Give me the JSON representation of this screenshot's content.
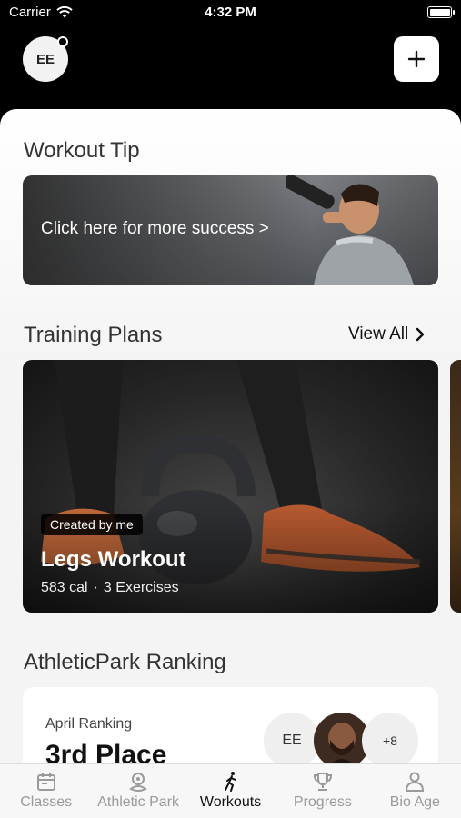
{
  "status": {
    "carrier": "Carrier",
    "time": "4:32 PM"
  },
  "header": {
    "avatar_initials": "EE",
    "add_icon": "plus-icon"
  },
  "tip": {
    "title": "Workout Tip",
    "cta": "Click here for more success >"
  },
  "plans": {
    "title": "Training Plans",
    "view_all": "View All",
    "card": {
      "badge": "Created by me",
      "name": "Legs Workout",
      "calories": "583 cal",
      "separator": "·",
      "exercises": "3 Exercises"
    }
  },
  "ranking": {
    "title": "AthleticPark Ranking",
    "label": "April Ranking",
    "place": "3rd Place",
    "avatars": {
      "first": "EE",
      "more": "+8"
    }
  },
  "tabs": [
    {
      "label": "Classes",
      "icon": "calendar-icon"
    },
    {
      "label": "Athletic Park",
      "icon": "location-pin-icon"
    },
    {
      "label": "Workouts",
      "icon": "runner-icon"
    },
    {
      "label": "Progress",
      "icon": "trophy-icon"
    },
    {
      "label": "Bio Age",
      "icon": "person-icon"
    }
  ],
  "colors": {
    "background": "#000000",
    "active_tab": "#111111",
    "inactive_tab": "#9a9a9a"
  }
}
